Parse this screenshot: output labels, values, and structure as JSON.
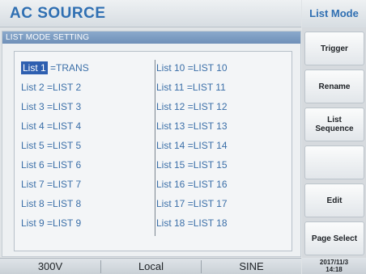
{
  "header": {
    "title": "AC SOURCE"
  },
  "panel": {
    "title": "LIST MODE SETTING"
  },
  "lists_left": [
    {
      "label": "List 1",
      "value": "=TRANS",
      "selected": true
    },
    {
      "label": "List 2",
      "value": "=LIST 2"
    },
    {
      "label": "List 3",
      "value": "=LIST 3"
    },
    {
      "label": "List 4",
      "value": "=LIST 4"
    },
    {
      "label": "List 5",
      "value": "=LIST 5"
    },
    {
      "label": "List 6",
      "value": "=LIST 6"
    },
    {
      "label": "List 7",
      "value": "=LIST 7"
    },
    {
      "label": "List 8",
      "value": "=LIST 8"
    },
    {
      "label": "List 9",
      "value": "=LIST 9"
    }
  ],
  "lists_right": [
    {
      "label": "List 10",
      "value": "=LIST 10"
    },
    {
      "label": "List 11",
      "value": "=LIST 11"
    },
    {
      "label": "List 12",
      "value": "=LIST 12"
    },
    {
      "label": "List 13",
      "value": "=LIST 13"
    },
    {
      "label": "List 14",
      "value": "=LIST 14"
    },
    {
      "label": "List 15",
      "value": "=LIST 15"
    },
    {
      "label": "List 16",
      "value": "=LIST 16"
    },
    {
      "label": "List 17",
      "value": "=LIST 17"
    },
    {
      "label": "List 18",
      "value": "=LIST 18"
    }
  ],
  "softkeys": {
    "title": "List Mode",
    "trigger": "Trigger",
    "rename": "Rename",
    "list_sequence": "List\nSequence",
    "blank": "",
    "edit": "Edit",
    "page_select": "Page Select"
  },
  "status": {
    "voltage_range": "300V",
    "control": "Local",
    "waveform": "SINE",
    "datetime": "2017/11/3\n14:18"
  },
  "colors": {
    "accent": "#2f6fb2",
    "selection": "#2e5fb0",
    "list_text": "#3b6fa8",
    "panel_title_bg": "#7b9bc2"
  }
}
